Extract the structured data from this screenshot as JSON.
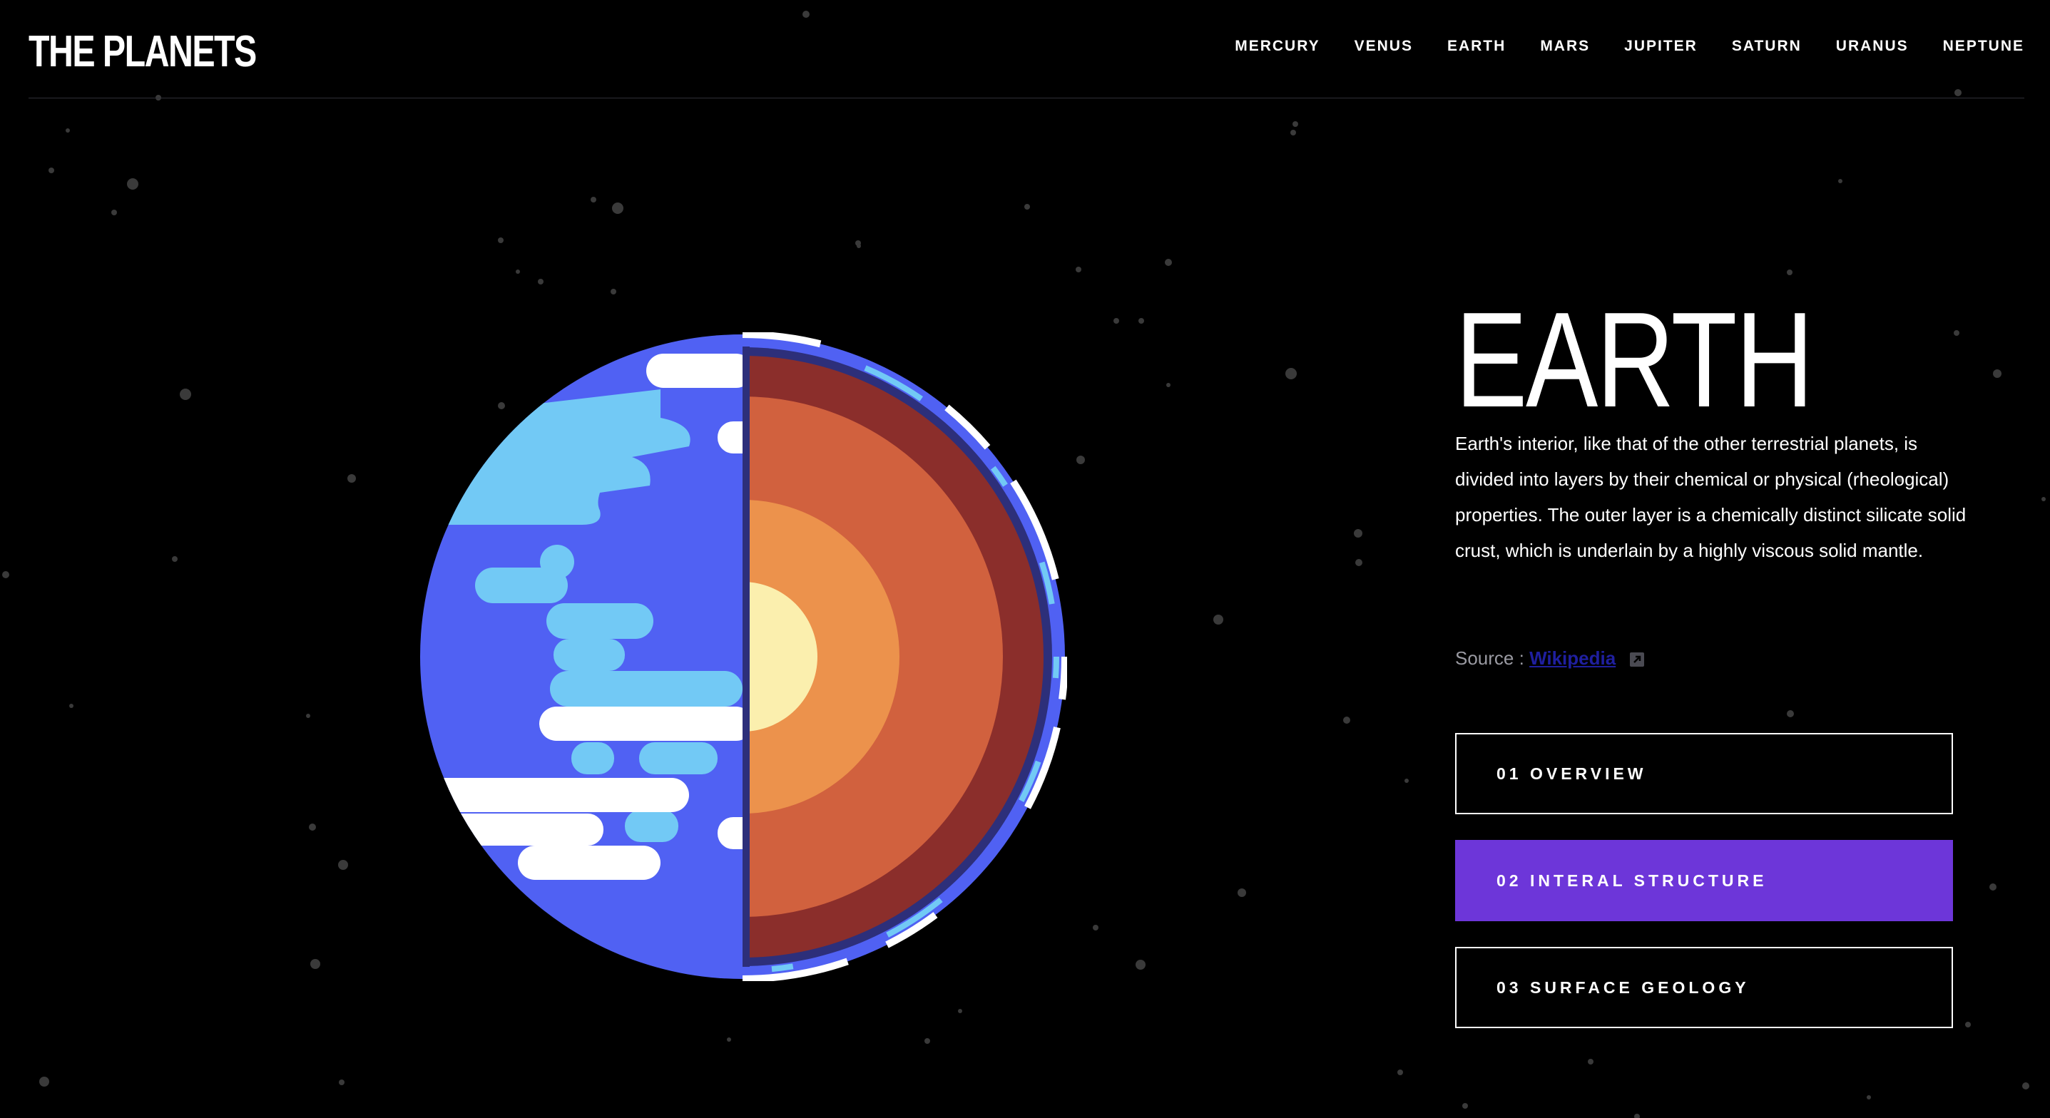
{
  "logo": "THE PLANETS",
  "nav": {
    "items": [
      {
        "label": "MERCURY"
      },
      {
        "label": "VENUS"
      },
      {
        "label": "EARTH"
      },
      {
        "label": "MARS"
      },
      {
        "label": "JUPITER"
      },
      {
        "label": "SATURN"
      },
      {
        "label": "URANUS"
      },
      {
        "label": "NEPTUNE"
      }
    ]
  },
  "planet": {
    "name": "EARTH",
    "image": "earth-internal-structure-illustration",
    "description": "Earth's interior, like that of the other terrestrial planets, is divided into layers by their chemical or physical (rheological) properties. The outer layer is a chemically distinct silicate solid crust, which is underlain by a highly viscous solid mantle.",
    "source_label": "Source :",
    "source_link": "Wikipedia",
    "source_icon": "external-link-icon"
  },
  "tabs": [
    {
      "label": "01 OVERVIEW",
      "active": false
    },
    {
      "label": "02 INTERAL STRUCTURE",
      "active": true
    },
    {
      "label": "03 SURFACE GEOLOGY",
      "active": false
    }
  ],
  "colors": {
    "background": "#000000",
    "active_tab": "#6d36d9",
    "ocean": "#5061f3",
    "land": "#72c9f5",
    "crust": "#8b2e2b",
    "mantle": "#d1613e",
    "outer_core": "#ec924c",
    "inner_core": "#fbefae"
  }
}
